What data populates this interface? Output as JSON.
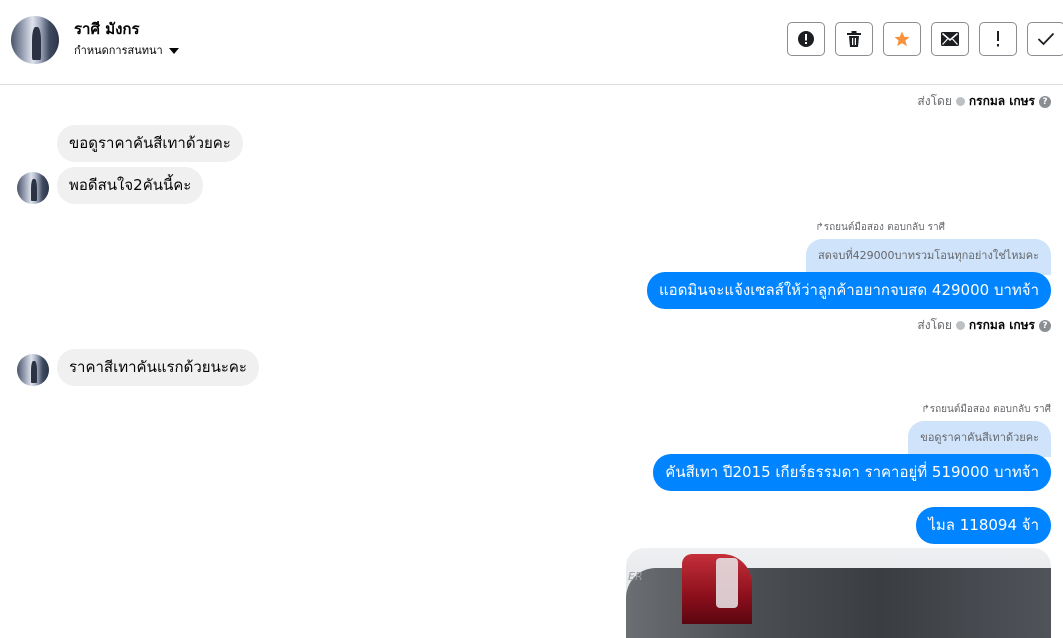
{
  "header": {
    "name": "ราศี มังกร",
    "subtitle": "กำหนดการสนทนา",
    "buttons": [
      {
        "icon": "alert-circle-icon"
      },
      {
        "icon": "trash-icon"
      },
      {
        "icon": "star-icon",
        "color": "#f7923a"
      },
      {
        "icon": "envelope-icon"
      },
      {
        "icon": "exclamation-icon"
      },
      {
        "icon": "check-icon"
      }
    ]
  },
  "messages": {
    "sent_by_1": {
      "prefix": "ส่งโดย",
      "name": "กรกมล เกษร"
    },
    "in_1": "ขอดูราคาคันสีเทาด้วยคะ",
    "in_2": "พอดีสนใจ2คันนี้คะ",
    "reply_header_1": "รถยนต์มือสอง ตอบกลับ ราศี",
    "quote_1": "สดจบที่429000บาทรวมโอนทุกอย่างใช่ไหมคะ",
    "out_1": "แอดมินจะแจ้งเซลส์ให้ว่าลูกค้าอยากจบสด 429000 บาทจ้า",
    "sent_by_2": {
      "prefix": "ส่งโดย",
      "name": "กรกมล เกษร"
    },
    "in_3": "ราคาสีเทาคันแรกด้วยนะคะ",
    "reply_header_2": "รถยนต์มือสอง ตอบกลับ ราศี",
    "quote_2": "ขอดูราคาคันสีเทาด้วยคะ",
    "out_2": "คันสีเทา ปี2015 เกียร์ธรรมดา ราคาอยู่ที่ 519000 บาทจ้า",
    "out_3": "ไมล 118094 จ้า"
  },
  "colors": {
    "accent": "#0084ff",
    "incoming_bubble": "#f0f0f0",
    "quote_bubble": "#cfe3fb"
  }
}
